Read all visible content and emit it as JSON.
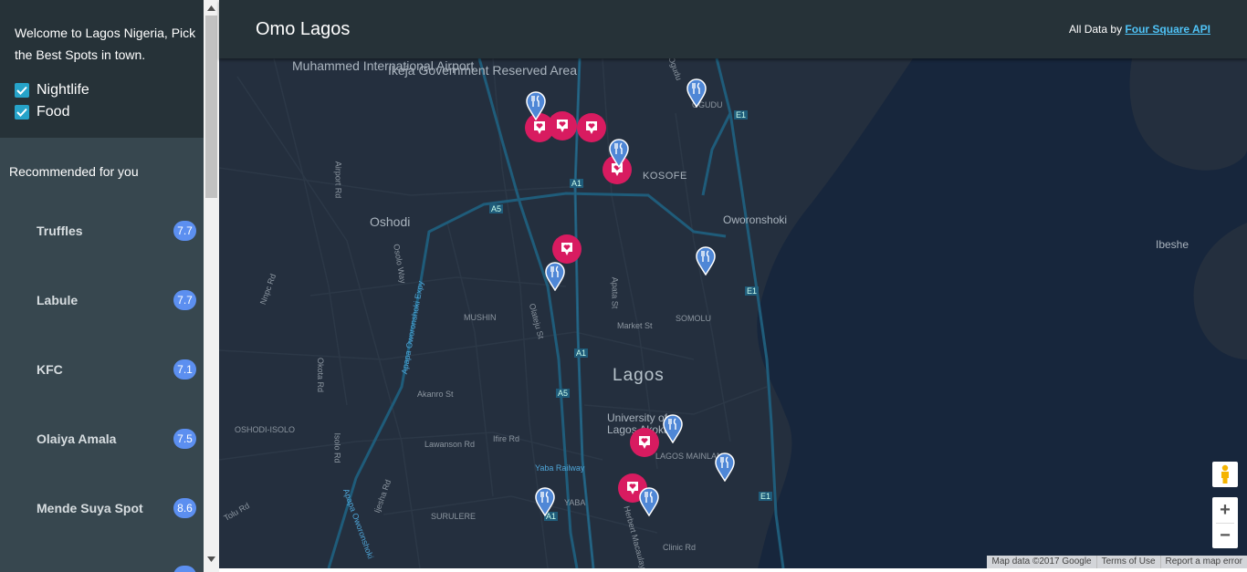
{
  "sidebar": {
    "welcome": "Welcome to Lagos Nigeria, Pick the Best Spots in town.",
    "filters": [
      {
        "label": "Nightlife",
        "checked": true
      },
      {
        "label": "Food",
        "checked": true
      }
    ],
    "recommended_heading": "Recommended for you",
    "venues": [
      {
        "name": "Truffles",
        "rating": "7.7"
      },
      {
        "name": "Labule",
        "rating": "7.7"
      },
      {
        "name": "KFC",
        "rating": "7.1"
      },
      {
        "name": "Olaiya Amala",
        "rating": "7.5"
      },
      {
        "name": "Mende Suya Spot",
        "rating": "8.6"
      }
    ]
  },
  "header": {
    "title": "Omo Lagos",
    "credit_prefix": "All Data by",
    "credit_link": "Four Square API"
  },
  "map": {
    "labels": {
      "airport": "Muhammed International Airport",
      "ikeja": "Ikeja Government Reserved Area",
      "ogudu": "OGUDU",
      "kosofe": "KOSOFE",
      "oshodi": "Oshodi",
      "oworonshoki": "Oworonshoki",
      "ibeshe": "Ibeshe",
      "mushin": "MUSHIN",
      "somolu": "SOMOLU",
      "lagos": "Lagos",
      "oshodi_isolo": "OSHODI-ISOLO",
      "university": "University of Lagos Akoka",
      "lagos_mainland": "LAGOS MAINLAND",
      "yaba_railway": "Yaba Railway",
      "yaba": "YABA",
      "surulere": "SURULERE",
      "akanro": "Akanro St",
      "lawanson": "Lawanson Rd",
      "ifire": "Ifire Rd",
      "market": "Market St",
      "apata": "Apata St",
      "olateju": "Olateju St",
      "airport_rd": "Airport Rd",
      "osolo": "Osolo Way",
      "okota": "Okota Rd",
      "isolo": "Isolo Rd",
      "ijesha": "Ijesha Rd",
      "clinic": "Clinic Rd",
      "apapa_expy": "Apapa Oworonshoki Expy",
      "apapa_oworonshoki": "Apapa Oworonshoki",
      "herbert": "Herbert Macaulay",
      "nnpc": "Nnpc Rd",
      "ogudu_rd": "Ogudu",
      "tolu": "Tolu Rd",
      "a1": "A1",
      "a5": "A5",
      "e1": "E1"
    },
    "controls": {
      "zoom_in": "+",
      "zoom_out": "−"
    },
    "attribution": {
      "data": "Map data ©2017 Google",
      "terms": "Terms of Use",
      "report": "Report a map error"
    },
    "colors": {
      "land": "#242f3e",
      "water": "#17263c",
      "road": "#38414e",
      "highway": "#1f5c7a",
      "nightlife_marker": "#d81b60",
      "food_marker": "#4f87d6"
    }
  }
}
